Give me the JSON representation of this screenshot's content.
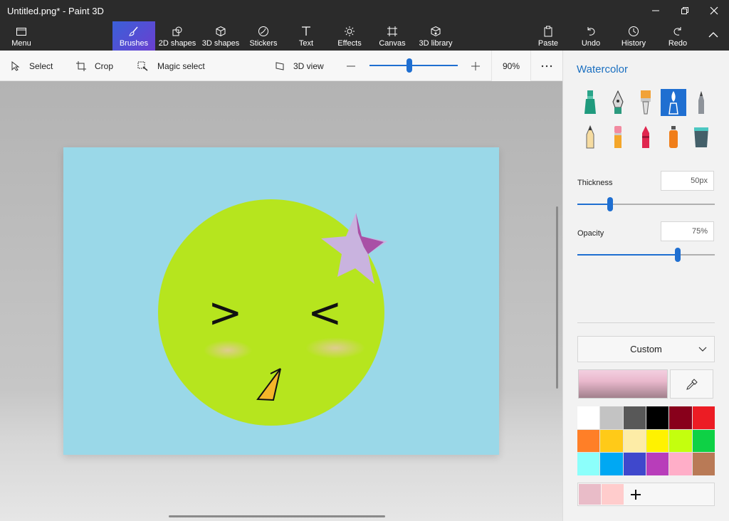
{
  "window": {
    "title": "Untitled.png* - Paint 3D",
    "controls": {
      "minimize": "minimize-icon",
      "maximize": "restore-icon",
      "close": "close-icon"
    }
  },
  "ribbon": {
    "menu_label": "Menu",
    "tools": [
      {
        "label": "Brushes",
        "icon": "brush-icon",
        "active": true
      },
      {
        "label": "2D shapes",
        "icon": "2d-shapes-icon"
      },
      {
        "label": "3D shapes",
        "icon": "3d-shapes-icon"
      },
      {
        "label": "Stickers",
        "icon": "stickers-icon"
      },
      {
        "label": "Text",
        "icon": "text-icon"
      },
      {
        "label": "Effects",
        "icon": "effects-icon"
      },
      {
        "label": "Canvas",
        "icon": "canvas-icon"
      },
      {
        "label": "3D library",
        "icon": "3d-library-icon"
      }
    ],
    "right": [
      {
        "label": "Paste",
        "icon": "paste-icon"
      },
      {
        "label": "Undo",
        "icon": "undo-icon"
      },
      {
        "label": "History",
        "icon": "history-icon"
      },
      {
        "label": "Redo",
        "icon": "redo-icon"
      }
    ]
  },
  "toolbar": {
    "select": "Select",
    "crop": "Crop",
    "magic_select": "Magic select",
    "view3d": "3D view",
    "zoom": "90%",
    "zoom_level": 0.45
  },
  "panel": {
    "title": "Watercolor",
    "thickness_label": "Thickness",
    "thickness_value": "50px",
    "thickness_level": 0.24,
    "opacity_label": "Opacity",
    "opacity_value": "75%",
    "opacity_level": 0.73,
    "color_mode": "Custom",
    "current_color": "#e9b8cc",
    "palette": [
      "#ffffff",
      "#c3c3c3",
      "#585858",
      "#000000",
      "#88001b",
      "#ec1c24",
      "#ff7f27",
      "#ffca18",
      "#fdeca6",
      "#fff200",
      "#c4ff0e",
      "#0ed145",
      "#8cfffb",
      "#00a8f3",
      "#3f48cc",
      "#b83dba",
      "#ffaec8",
      "#b97a56"
    ],
    "custom_colors": [
      "#e9bcc8",
      "#ffcccc"
    ]
  },
  "canvas": {
    "background": "#9ad8e8",
    "face_color": "#b6e51e",
    "star_color": "#c9b3df",
    "star_accent": "#a950a6",
    "eyes": [
      ">",
      "<"
    ]
  }
}
